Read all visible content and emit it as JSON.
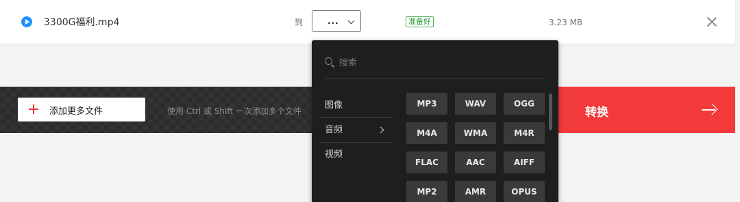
{
  "file": {
    "name": "3300G福利.mp4",
    "to_label": "到",
    "selected_format": "...",
    "status": "准备好",
    "size": "3.23 MB"
  },
  "action_bar": {
    "add_files_label": "添加更多文件",
    "hint": "使用 Ctrl 或 Shift 一次添加多个文件",
    "convert_label": "转换"
  },
  "dropdown": {
    "search_placeholder": "搜索",
    "categories": [
      {
        "label": "图像"
      },
      {
        "label": "音频"
      },
      {
        "label": "视频"
      }
    ],
    "formats": [
      "MP3",
      "WAV",
      "OGG",
      "M4A",
      "WMA",
      "M4R",
      "FLAC",
      "AAC",
      "AIFF",
      "MP2",
      "AMR",
      "OPUS"
    ]
  },
  "colors": {
    "accent_red": "#f23a3a",
    "play_blue": "#1e90ff",
    "status_green": "#2e9d3a",
    "dropdown_bg": "#1e1e1e"
  }
}
